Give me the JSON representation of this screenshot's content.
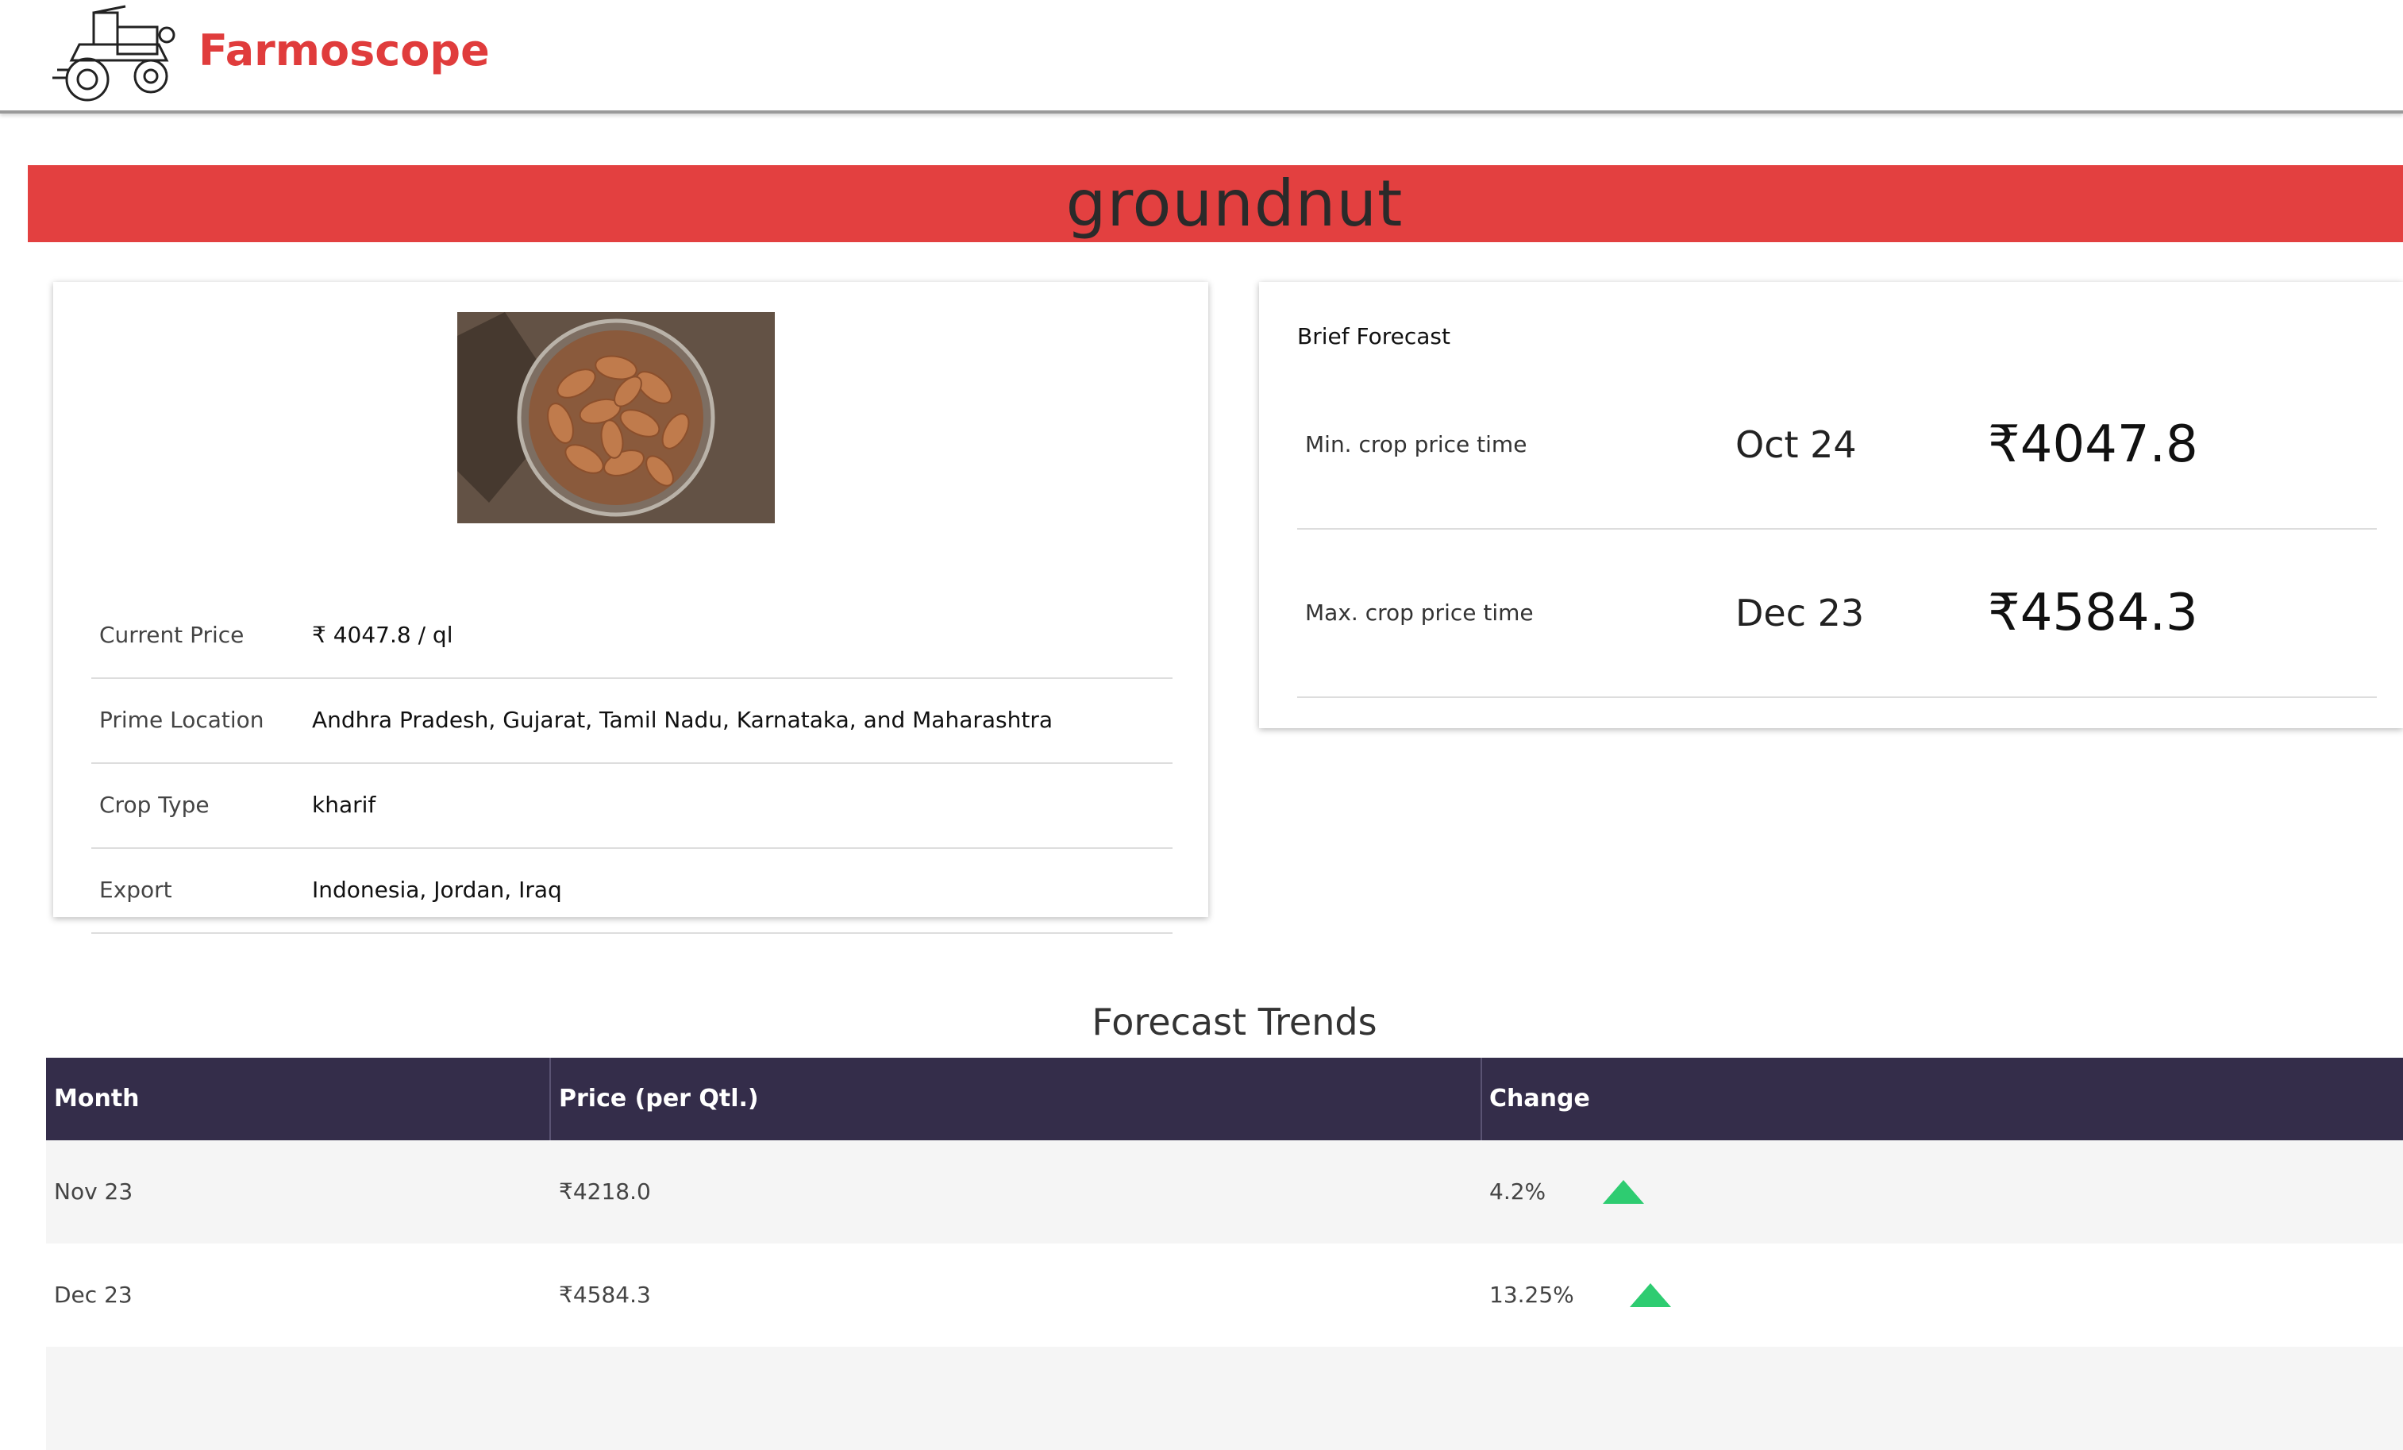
{
  "header": {
    "brand": "Farmoscope",
    "logo_icon": "tractor-icon"
  },
  "crop": {
    "name": "groundnut",
    "image_icon": "groundnut-bowl-photo"
  },
  "details": [
    {
      "label": "Current Price",
      "value": "₹ 4047.8 / ql"
    },
    {
      "label": "Prime Location",
      "value": "Andhra Pradesh, Gujarat, Tamil Nadu, Karnataka, and Maharashtra"
    },
    {
      "label": "Crop Type",
      "value": "kharif"
    },
    {
      "label": "Export",
      "value": "Indonesia, Jordan, Iraq"
    }
  ],
  "brief_forecast": {
    "title": "Brief Forecast",
    "min": {
      "label": "Min. crop price time",
      "date": "Oct 24",
      "price": "₹4047.8"
    },
    "max": {
      "label": "Max. crop price time",
      "date": "Dec 23",
      "price": "₹4584.3"
    }
  },
  "forecast_trends": {
    "title": "Forecast Trends",
    "columns": [
      "Month",
      "Price (per Qtl.)",
      "Change"
    ],
    "rows": [
      {
        "month": "Nov 23",
        "price": "₹4218.0",
        "change": "4.2%",
        "direction": "up"
      },
      {
        "month": "Dec 23",
        "price": "₹4584.3",
        "change": "13.25%",
        "direction": "up"
      },
      {
        "month": "",
        "price": "",
        "change": "",
        "direction": ""
      }
    ],
    "up_color": "#2ecc71"
  },
  "colors": {
    "brand": "#e03c3c",
    "title_bar": "#e34040",
    "table_header": "#342d4a"
  }
}
